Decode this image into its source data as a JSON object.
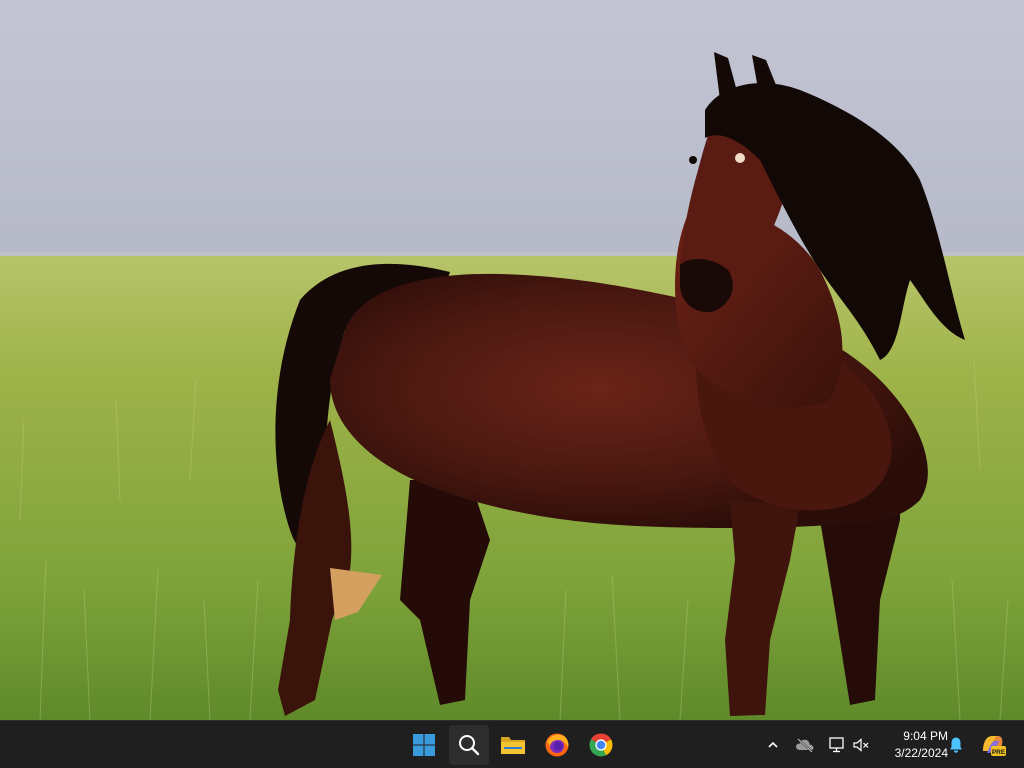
{
  "desktop": {
    "wallpaper": "horse-in-grass-field"
  },
  "taskbar": {
    "apps": [
      {
        "name": "start",
        "icon": "windows-logo-icon"
      },
      {
        "name": "search",
        "icon": "search-icon"
      },
      {
        "name": "file-explorer",
        "icon": "folder-icon"
      },
      {
        "name": "firefox",
        "icon": "firefox-icon"
      },
      {
        "name": "chrome",
        "icon": "chrome-icon"
      }
    ],
    "tray": {
      "icons": [
        "chevron-up-icon",
        "cloud-offline-icon",
        "network-icon",
        "volume-muted-icon",
        "notification-bell-icon",
        "copilot-pre-icon"
      ],
      "badge": "PRE"
    },
    "clock": {
      "time": "9:04 PM",
      "date": "3/22/2024"
    }
  },
  "colors": {
    "taskbar_bg": "#1f1f1f",
    "accent_blue": "#3a9bdc",
    "folder_yellow": "#f4c430"
  }
}
